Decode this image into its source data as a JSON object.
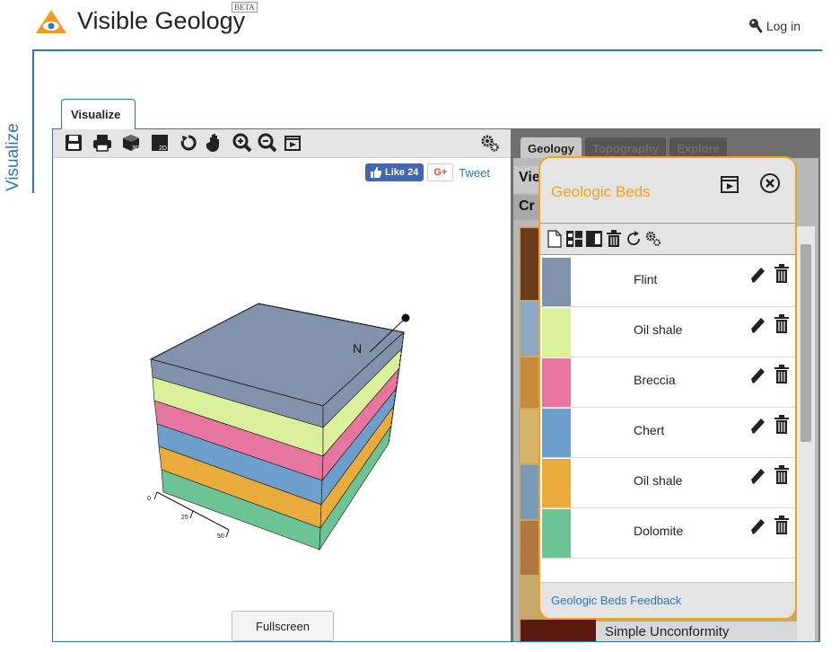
{
  "header": {
    "app_title": "Visible Geology",
    "beta_badge": "BETA",
    "login_label": "Log in"
  },
  "sidebar": {
    "section_label": "Visualize"
  },
  "main_tab": {
    "label": "Visualize"
  },
  "toolbar": {
    "icons": [
      "save-icon",
      "print-icon",
      "3d-view-icon",
      "2d-view-icon",
      "rotate-icon",
      "pan-hand-icon",
      "zoom-in-icon",
      "zoom-out-icon",
      "presentation-icon",
      "settings-gears-icon"
    ]
  },
  "social": {
    "like_label": "Like 24",
    "gplus_label": "G+",
    "tweet_label": "Tweet"
  },
  "model": {
    "north_label": "N",
    "scale_labels": [
      "0",
      "25",
      "50"
    ]
  },
  "fullscreen_label": "Fullscreen",
  "right_pane": {
    "tabs": [
      "Geology",
      "Topography",
      "Explore"
    ],
    "strip_1": "Vie",
    "strip_2": "Cr",
    "last_item": "Simple Unconformity"
  },
  "beds_panel": {
    "title": "Geologic Beds",
    "beds": [
      {
        "name": "Flint",
        "color": "#8292ad"
      },
      {
        "name": "Oil shale",
        "color": "#dbf09a"
      },
      {
        "name": "Breccia",
        "color": "#e6769f"
      },
      {
        "name": "Chert",
        "color": "#6c9fcc"
      },
      {
        "name": "Oil shale",
        "color": "#eaab3d"
      },
      {
        "name": "Dolomite",
        "color": "#6cc494"
      }
    ],
    "feedback_link": "Geologic Beds Feedback"
  },
  "colors": {
    "accent_blue": "#2a78b5",
    "panel_orange": "#f0a21e"
  }
}
